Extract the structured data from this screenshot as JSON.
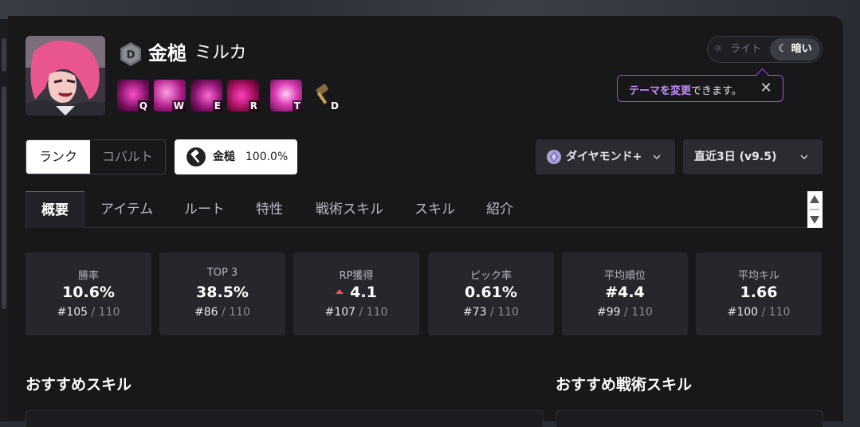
{
  "character": {
    "tier": "D",
    "name": "金槌",
    "subname": "ミルカ",
    "skills": [
      {
        "key": "Q",
        "icon": "skill-q-icon"
      },
      {
        "key": "W",
        "icon": "skill-w-icon"
      },
      {
        "key": "E",
        "icon": "skill-e-icon"
      },
      {
        "key": "R",
        "icon": "skill-r-icon"
      },
      {
        "key": "T",
        "icon": "skill-t-icon"
      },
      {
        "key": "D",
        "icon": "skill-d-icon"
      }
    ]
  },
  "theme": {
    "light_label": "ライト",
    "dark_label": "暗い",
    "tooltip_highlight": "テーマを変更",
    "tooltip_rest": "できます。"
  },
  "mode_toggle": {
    "active": "ランク",
    "inactive": "コバルト"
  },
  "weapon": {
    "label": "金槌",
    "percent": "100.0%"
  },
  "filters": {
    "tier": "ダイヤモンド+",
    "period": "直近3日 (v9.5)"
  },
  "tabs": [
    "概要",
    "アイテム",
    "ルート",
    "特性",
    "戦術スキル",
    "スキル",
    "紹介"
  ],
  "stats": [
    {
      "label": "勝率",
      "value": "10.6%",
      "rank": "#105",
      "total": " / 110"
    },
    {
      "label": "TOP 3",
      "value": "38.5%",
      "rank": "#86",
      "total": " / 110"
    },
    {
      "label": "RP獲得",
      "value": "4.1",
      "rank": "#107",
      "total": " / 110",
      "trend": "up"
    },
    {
      "label": "ピック率",
      "value": "0.61%",
      "rank": "#73",
      "total": " / 110"
    },
    {
      "label": "平均順位",
      "value": "#4.4",
      "rank": "#99",
      "total": " / 110"
    },
    {
      "label": "平均キル",
      "value": "1.66",
      "rank": "#100",
      "total": " / 110"
    }
  ],
  "sections": {
    "skills_title": "おすすめスキル",
    "tactical_title": "おすすめ戦術スキル"
  },
  "colors": {
    "accent": "#a64bf4",
    "trend_up": "#ef5350",
    "panel": "#18181b",
    "card": "#26272c"
  }
}
